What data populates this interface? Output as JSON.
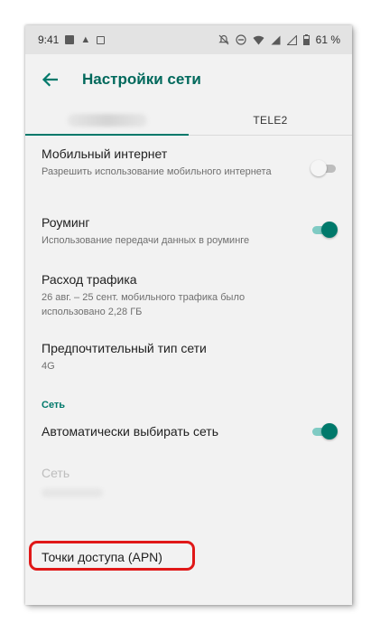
{
  "status_bar": {
    "time": "9:41",
    "battery": "61 %",
    "left_icons": [
      "image-icon",
      "app-icon",
      "app2-icon"
    ],
    "right_icons": [
      "mute-icon",
      "dnd-icon",
      "wifi-icon",
      "signal-icon",
      "signal2-icon",
      "battery-icon"
    ]
  },
  "appbar": {
    "title": "Настройки сети"
  },
  "tabs": [
    {
      "label": "",
      "selected": true,
      "blurred": true
    },
    {
      "label": "TELE2",
      "selected": false
    }
  ],
  "settings": {
    "mobile_data": {
      "title": "Мобильный интернет",
      "subtitle": "Разрешить использование мобильного интернета",
      "enabled": false
    },
    "roaming": {
      "title": "Роуминг",
      "subtitle": "Использование передачи данных в роуминге",
      "enabled": true
    },
    "data_usage": {
      "title": "Расход трафика",
      "subtitle": "26 авг. – 25 сент. мобильного трафика было использовано 2,28 ГБ"
    },
    "network_type": {
      "title": "Предпочтительный тип сети",
      "subtitle": "4G"
    }
  },
  "network_section": {
    "label": "Сеть",
    "auto_select": {
      "title": "Автоматически выбирать сеть",
      "enabled": true
    },
    "network": {
      "title": "Сеть",
      "disabled": true
    }
  },
  "apn": {
    "title": "Точки доступа (APN)",
    "highlighted": true
  },
  "colors": {
    "accent": "#00796b",
    "title": "#00695c",
    "highlight": "#e01818"
  }
}
